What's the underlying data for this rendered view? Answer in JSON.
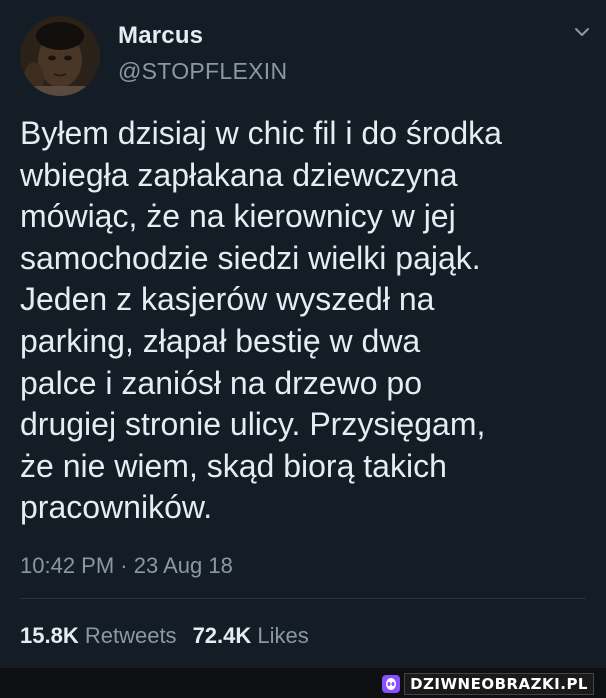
{
  "author": {
    "name": "Marcus",
    "handle": "@STOPFLEXIN"
  },
  "tweet": {
    "text": "Byłem dzisiaj w chic fil i do środka\nwbiegła zapłakana dziewczyna\nmówiąc, że na kierownicy w jej\nsamochodzie siedzi wielki pająk.\nJeden z kasjerów wyszedł na\nparking, złapał bestię w dwa\npalce i zaniósł na drzewo po\ndrugiej stronie ulicy. Przysięgam,\nże nie wiem, skąd biorą takich\npracowników.",
    "timestamp": "10:42 PM · 23 Aug 18"
  },
  "stats": {
    "retweets_count": "15.8K",
    "retweets_label": "Retweets",
    "likes_count": "72.4K",
    "likes_label": "Likes"
  },
  "watermark": {
    "text": "DZIWNEOBRAZKI.PL"
  },
  "colors": {
    "background": "#141d26",
    "primary_text": "#e6ecf0",
    "secondary_text": "#8899a6"
  },
  "icons": {
    "menu": "chevron-down-icon",
    "watermark": "alien-icon"
  }
}
